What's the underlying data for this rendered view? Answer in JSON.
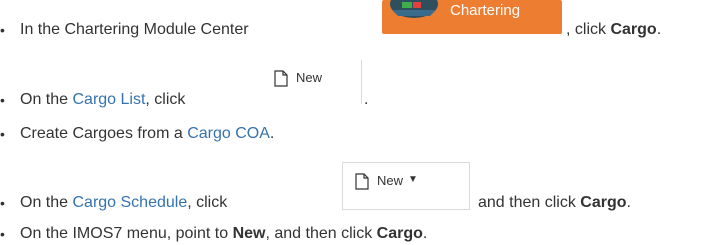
{
  "items": [
    {
      "bullet": "•",
      "pre": "In the Chartering Module Center",
      "post": ", click ",
      "bold": "Cargo",
      "end": "."
    },
    {
      "bullet": "•",
      "pre": "On the ",
      "link": "Cargo List",
      "post": ", click",
      "end": "."
    },
    {
      "bullet": "•",
      "pre": "Create Cargoes from a ",
      "link": "Cargo COA",
      "end": "."
    },
    {
      "bullet": "•",
      "pre": "On the ",
      "link": "Cargo Schedule",
      "post": ", click",
      "post2": "and then click ",
      "bold": "Cargo",
      "end": "."
    },
    {
      "bullet": "•",
      "pre": "On the IMOS7 menu, point to ",
      "bold": "New",
      "mid": ", and then click ",
      "bold2": "Cargo",
      "end": "."
    }
  ],
  "chartering_button": {
    "label": "Chartering",
    "icon": "ship-icon"
  },
  "new_button": {
    "label": "New",
    "icon": "document-icon"
  },
  "new_dropdown_button": {
    "label": "New",
    "icon": "document-icon",
    "caret": "▼"
  },
  "colors": {
    "link": "#3572b0",
    "chartering_bg": "#ed7d31",
    "text": "#333333"
  }
}
